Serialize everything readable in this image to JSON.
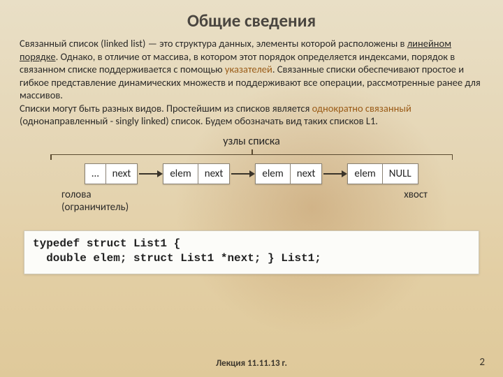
{
  "title": "Общие сведения",
  "para_html": "Связанный список (linked list) — это структура данных, элементы которой расположены в <span class='ul'>линейном порядке</span>. Однако, в отличие от массива, в котором этот порядок определяется индексами, порядок в связанном списке поддерживается с помощью <span class='hl'>указателей</span>. Связанные списки обеспечивают простое и гибкое представление динамических множеств и поддерживают все операции, рассмотренные ранее для массивов.<br>Списки могут быть разных видов. Простейшим из списков является <span class='hl'>однократно связанный</span> (однонаправленный - singly linked) список. Будем обозначать вид таких списков L1.",
  "caption": "узлы списка",
  "nodes": [
    {
      "cells": [
        "…",
        "next"
      ]
    },
    {
      "cells": [
        "elem",
        "next"
      ]
    },
    {
      "cells": [
        "elem",
        "next"
      ]
    },
    {
      "cells": [
        "elem",
        "NULL"
      ]
    }
  ],
  "labels": {
    "head_line1": "голова",
    "head_line2": "(ограничитель)",
    "tail": "хвост"
  },
  "code": "typedef struct List1 {\n  double elem; struct List1 *next; } List1;",
  "footer": "Лекция  11.11.13 г.",
  "page_number": "2"
}
